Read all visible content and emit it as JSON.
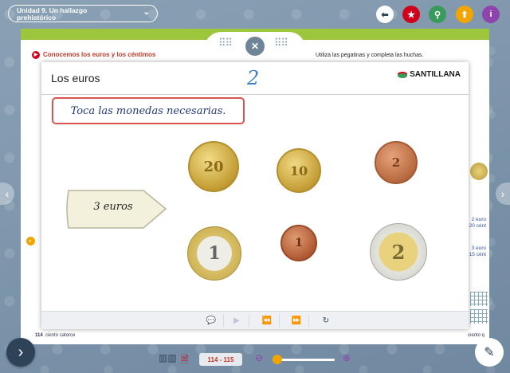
{
  "unit_selector": {
    "line1": "Unidad 9. Un hallazgo",
    "line2": "prehistórico"
  },
  "top_buttons": [
    {
      "name": "back",
      "glyph": "⬅",
      "color": "#ffffff",
      "fg": "#2e4358"
    },
    {
      "name": "favorite",
      "glyph": "★",
      "color": "#d0021b",
      "fg": "#ffffff"
    },
    {
      "name": "search",
      "glyph": "⚲",
      "color": "#3a9a5b",
      "fg": "#ffffff"
    },
    {
      "name": "upload",
      "glyph": "⬆",
      "color": "#f0a500",
      "fg": "#ffffff"
    },
    {
      "name": "info",
      "glyph": "i",
      "color": "#8e44ad",
      "fg": "#ffffff"
    }
  ],
  "book": {
    "section_title": "Conocemos los euros y los céntimos",
    "instruction": "Utiliza las pegatinas y completa las huchas.",
    "right_texts": [
      "2 euro",
      "20 cént",
      "3 euro",
      "15 cént"
    ],
    "page_left": "114",
    "page_left_words": "ciento catorce",
    "page_right_words": "ciento q"
  },
  "modal": {
    "title": "Los euros",
    "number": "2",
    "brand": "SANTILLANA",
    "prompt": "Toca las monedas necesarias.",
    "tag_label": "3 euros",
    "coins": [
      {
        "name": "coin-20-cent",
        "label": "20",
        "color": "#d9b84a"
      },
      {
        "name": "coin-10-cent",
        "label": "10",
        "color": "#d9b84a"
      },
      {
        "name": "coin-2-cent",
        "label": "2",
        "color": "#b9663b"
      },
      {
        "name": "coin-1-euro",
        "label": "1",
        "color": "#d8d8d0"
      },
      {
        "name": "coin-1-cent",
        "label": "1",
        "color": "#b35a32"
      },
      {
        "name": "coin-2-euro",
        "label": "2",
        "color": "#e2cf7e"
      }
    ]
  },
  "footer_buttons": [
    "comment",
    "play",
    "rewind",
    "fast-forward",
    "reload"
  ],
  "bottom_bar": {
    "page_range": "114 - 115"
  }
}
